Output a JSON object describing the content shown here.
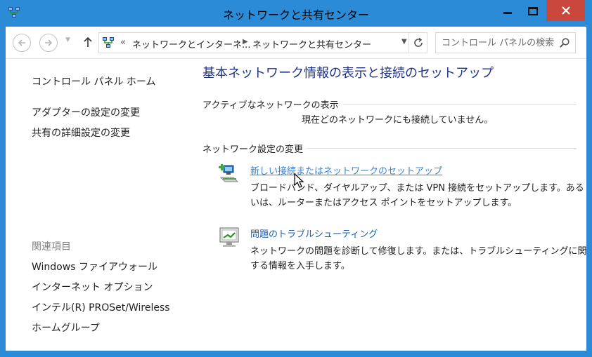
{
  "window": {
    "title": "ネットワークと共有センター",
    "accent": "#2b8bd6",
    "close_color": "#c9473c"
  },
  "toolbar": {
    "back_icon": "arrow-left-icon",
    "forward_icon": "arrow-right-icon",
    "up_icon": "arrow-up-icon",
    "refresh_icon": "refresh-icon"
  },
  "address": {
    "chevron": "«",
    "crumb1": "ネットワークとインターネ...",
    "crumb2": "ネットワークと共有センター"
  },
  "search": {
    "placeholder": "コントロール パネルの検索"
  },
  "sidebar": {
    "home": "コントロール パネル ホーム",
    "links": [
      "アダプターの設定の変更",
      "共有の詳細設定の変更"
    ],
    "related_heading": "関連項目",
    "related": [
      "Windows ファイアウォール",
      "インターネット オプション",
      "インテル(R) PROSet/Wireless",
      "ホームグループ"
    ]
  },
  "main": {
    "title": "基本ネットワーク情報の表示と接続のセットアップ",
    "active_section": "アクティブなネットワークの表示",
    "no_network": "現在どのネットワークにも接続していません。",
    "settings_section": "ネットワーク設定の変更",
    "tasks": [
      {
        "label": "新しい接続またはネットワークのセットアップ",
        "description": "ブロードバンド、ダイヤルアップ、または VPN 接続をセットアップします。あるいは、ルーターまたはアクセス ポイントをセットアップします。"
      },
      {
        "label": "問題のトラブルシューティング",
        "description": "ネットワークの問題を診断して修復します。または、トラブルシューティングに関する情報を入手します。"
      }
    ]
  }
}
